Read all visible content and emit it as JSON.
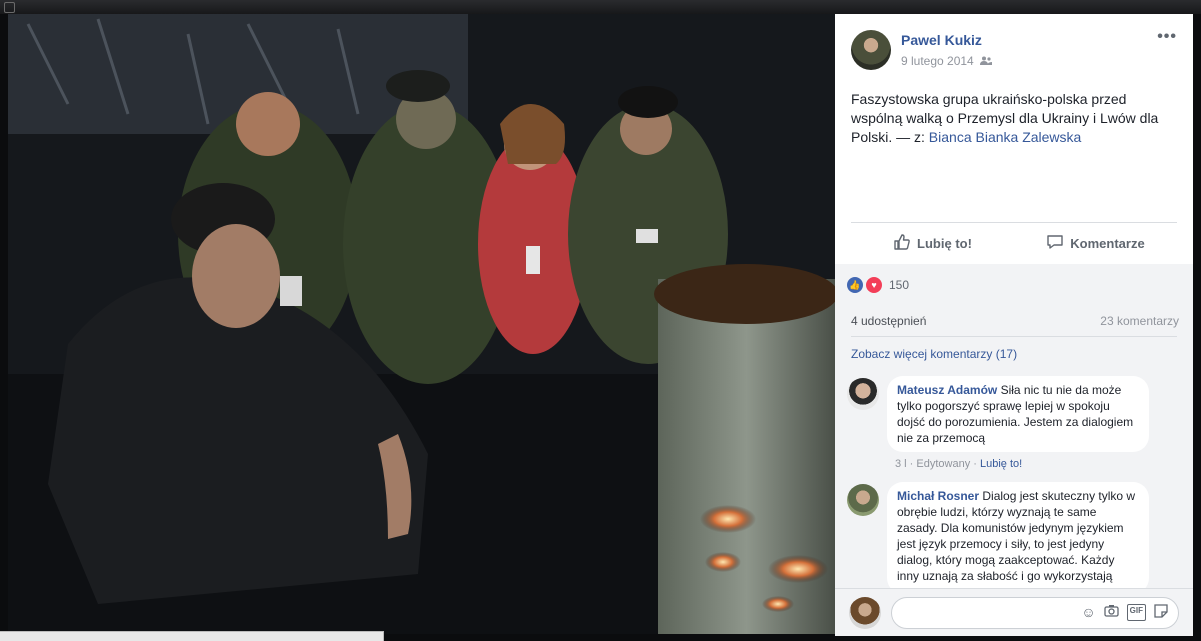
{
  "post": {
    "author": "Pawel Kukiz",
    "date": "9 lutego 2014",
    "text_main": "Faszystowska grupa ukraińsko-polska przed wspólną walką o Przemysl dla Ukrainy i Lwów dla Polski.",
    "text_with": " — z: ",
    "tagged": "Bianca Bianka Zalewska"
  },
  "actions": {
    "like_label": "Lubię to!",
    "comment_label": "Komentarze"
  },
  "stats": {
    "reaction_count": "150",
    "shares": "4 udostępnień",
    "comments": "23 komentarzy"
  },
  "more_comments": "Zobacz więcej komentarzy (17)",
  "comments": [
    {
      "name": "Mateusz Adamów",
      "text": " Siła nic tu nie da może tylko pogorszyć sprawę lepiej w spokoju dojść do porozumienia. Jestem za dialogiem nie za przemocą",
      "meta_time": "3 l",
      "meta_edited": "Edytowany",
      "meta_like": "Lubię to!"
    },
    {
      "name": "Michał Rosner",
      "text": " Dialog jest skuteczny tylko w obrębie ludzi, którzy wyznają te same zasady. Dla komunistów jedynym językiem jest język przemocy i siły, to jest jedyny dialog, który mogą zaakceptować. Każdy inny uznają za słabość i go wykorzystają"
    }
  ],
  "icons": {
    "more": "more-options-icon",
    "friends": "friends-privacy-icon",
    "like": "thumbs-up-icon",
    "comment": "speech-bubble-icon",
    "emoji": "emoji-icon",
    "camera": "camera-icon",
    "gif": "gif-icon",
    "sticker": "sticker-icon"
  },
  "colors": {
    "link": "#365899",
    "like": "#4267b2",
    "love": "#f33e58"
  }
}
